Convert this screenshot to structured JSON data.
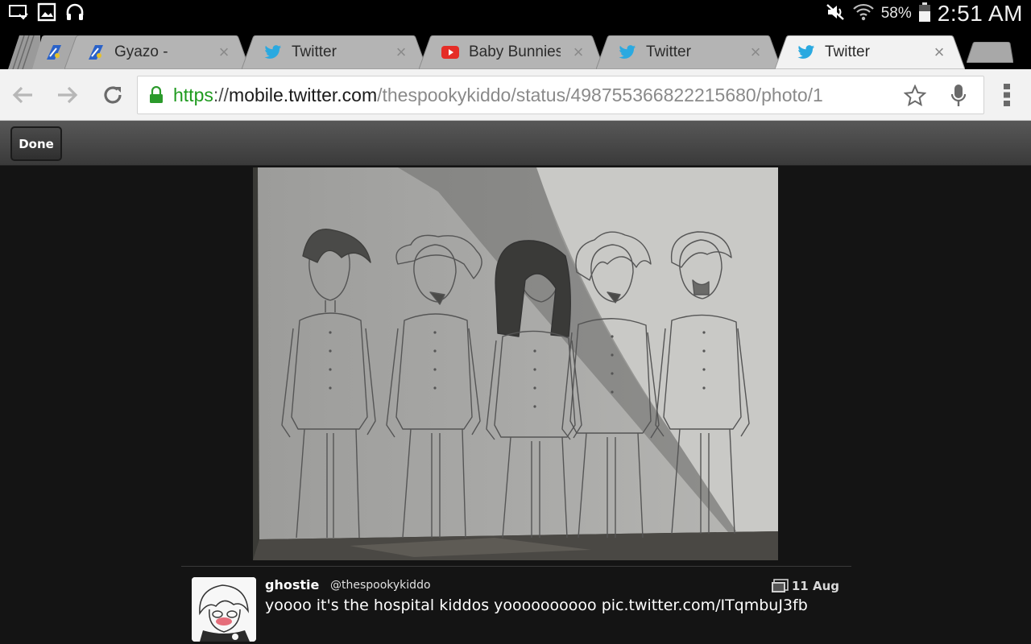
{
  "status_bar": {
    "left_icons": [
      "screen-mirror-icon",
      "gallery-icon",
      "headphones-icon"
    ],
    "right_icons": [
      "mute-icon",
      "wifi-icon",
      "battery-icon"
    ],
    "battery_percent": "58%",
    "clock": "2:51 AM"
  },
  "tabs": [
    {
      "title": "",
      "favicon": "gyazo-icon",
      "active": false
    },
    {
      "title": "Gyazo -",
      "favicon": "gyazo-icon",
      "active": false
    },
    {
      "title": "Twitter",
      "favicon": "twitter-bird-icon",
      "active": false
    },
    {
      "title": "Baby Bunnies",
      "favicon": "youtube-icon",
      "active": false
    },
    {
      "title": "Twitter",
      "favicon": "twitter-bird-icon",
      "active": false
    },
    {
      "title": "Twitter",
      "favicon": "twitter-bird-icon",
      "active": true
    }
  ],
  "tab_close_glyph": "×",
  "toolbar": {
    "url_scheme": "https",
    "url_sep": "://",
    "url_host": "mobile.twitter.com",
    "url_path": "/thespookykiddo/status/498755366822215680/photo/1"
  },
  "viewer": {
    "done_label": "Done"
  },
  "tweet": {
    "name": "ghostie",
    "handle": "@thespookykiddo",
    "date": "11 Aug",
    "text": "yoooo it's the hospital kiddos yoooooooooo pic.twitter.com/ITqmbuJ3fb"
  },
  "colors": {
    "url_secure": "#1e9a1e",
    "twitter_blue": "#2aa9e0",
    "youtube_red": "#e52d27"
  }
}
